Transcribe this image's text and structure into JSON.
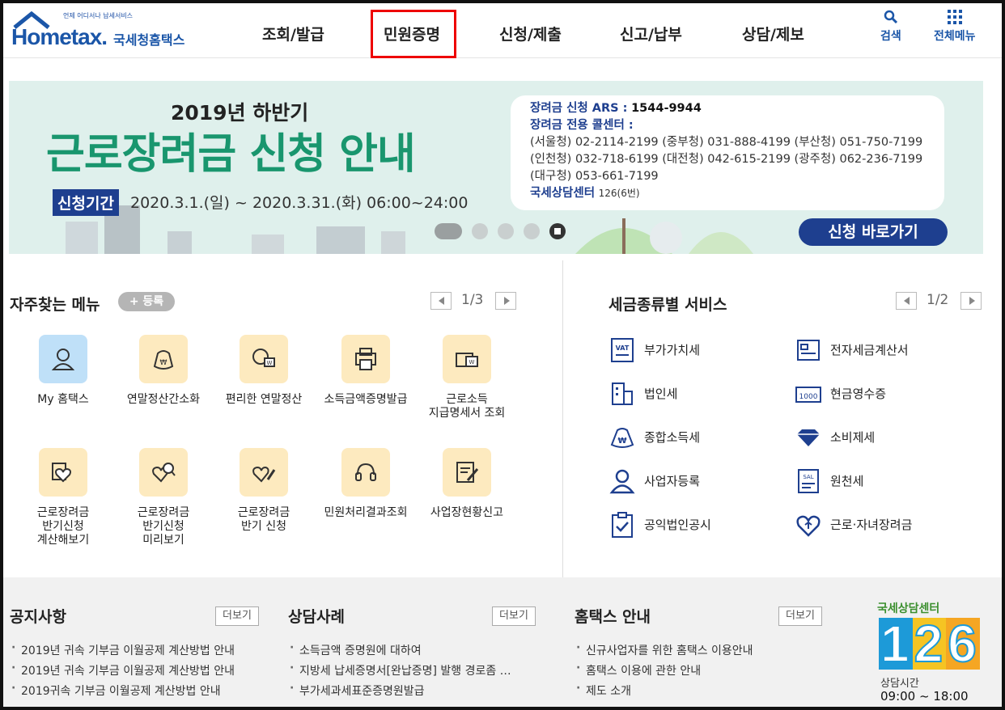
{
  "header": {
    "logo_tag": "언제 어디서나 납세서비스",
    "logo_text": "Hometax.",
    "logo_kr": "국세청홈택스",
    "nav": [
      "조회/발급",
      "민원증명",
      "신청/제출",
      "신고/납부",
      "상담/제보"
    ],
    "search_label": "검색",
    "menu_label": "전체메뉴"
  },
  "banner": {
    "subtitle": "2019년 하반기",
    "title": "근로장려금 신청 안내",
    "period_tag": "신청기간",
    "period": "2020.3.1.(일) ~ 2020.3.31.(화) 06:00~24:00",
    "ars_label": "장려금 신청 ARS :",
    "ars_number": "1544-9944",
    "call_label": "장려금 전용 콜센터 :",
    "call_line1": "(서울청) 02-2114-2199 (중부청) 031-888-4199 (부산청) 051-750-7199",
    "call_line2": "(인천청) 032-718-6199 (대전청) 042-615-2199 (광주청) 062-236-7199",
    "call_line3": "(대구청) 053-661-7199",
    "center_label": "국세상담센터",
    "center_number": "126(6번)",
    "apply_button": "신청 바로가기"
  },
  "frequent": {
    "title": "자주찾는 메뉴",
    "register": "+ 등록",
    "page": "1/3",
    "items": [
      {
        "label": "My 홈택스"
      },
      {
        "label": "연말정산간소화"
      },
      {
        "label": "편리한 연말정산"
      },
      {
        "label": "소득금액증명발급"
      },
      {
        "label": "근로소득\n지급명세서 조회"
      },
      {
        "label": "근로장려금\n반기신청\n계산해보기"
      },
      {
        "label": "근로장려금\n반기신청\n미리보기"
      },
      {
        "label": "근로장려금\n반기 신청"
      },
      {
        "label": "민원처리결과조회"
      },
      {
        "label": "사업장현황신고"
      }
    ]
  },
  "tax_services": {
    "title": "세금종류별 서비스",
    "page": "1/2",
    "items": [
      {
        "label": "부가가치세"
      },
      {
        "label": "전자세금계산서"
      },
      {
        "label": "법인세"
      },
      {
        "label": "현금영수증"
      },
      {
        "label": "종합소득세"
      },
      {
        "label": "소비제세"
      },
      {
        "label": "사업자등록"
      },
      {
        "label": "원천세"
      },
      {
        "label": "공익법인공시"
      },
      {
        "label": "근로·자녀장려금"
      }
    ]
  },
  "notice": {
    "title": "공지사항",
    "more": "더보기",
    "items": [
      "2019년 귀속 기부금 이월공제 계산방법 안내",
      "2019년 귀속 기부금 이월공제 계산방법 안내",
      "2019귀속 기부금 이월공제 계산방법 안내"
    ]
  },
  "cases": {
    "title": "상담사례",
    "more": "더보기",
    "items": [
      "소득금액 증명원에 대하여",
      "지방세 납세증명서[완납증명] 발행 경로좀 …",
      "부가세과세표준증명원발급"
    ]
  },
  "guide": {
    "title": "홈택스 안내",
    "more": "더보기",
    "items": [
      "신규사업자를 위한 홈택스 이용안내",
      "홈택스 이용에 관한 안내",
      "제도 소개"
    ]
  },
  "center": {
    "label": "국세상담센터",
    "d1": "1",
    "d2": "2",
    "d3": "6",
    "hours_label": "상담시간",
    "hours": "09:00 ~ 18:00"
  }
}
